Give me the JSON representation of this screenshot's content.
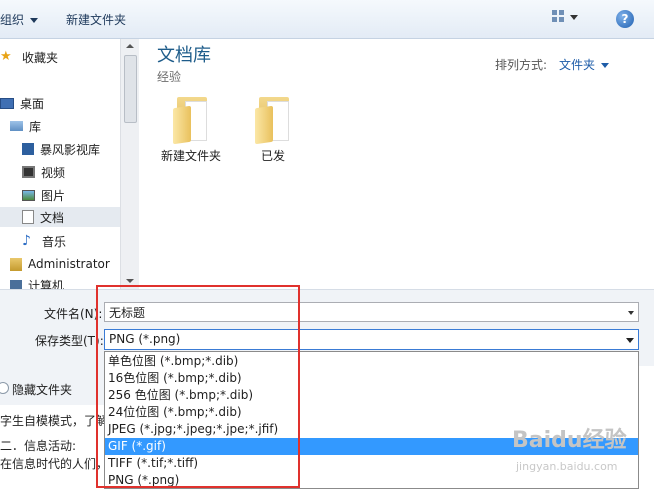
{
  "toolbar": {
    "organize": "组织",
    "new_folder": "新建文件夹",
    "help": "?"
  },
  "sidebar": {
    "items": [
      {
        "label": "收藏夹",
        "icon": "star-icon"
      },
      {
        "label": "桌面",
        "icon": "desktop-icon"
      },
      {
        "label": "库",
        "icon": "library-icon"
      },
      {
        "label": "暴风影视库",
        "icon": "video-library-icon"
      },
      {
        "label": "视频",
        "icon": "video-icon"
      },
      {
        "label": "图片",
        "icon": "picture-icon"
      },
      {
        "label": "文档",
        "icon": "document-icon"
      },
      {
        "label": "音乐",
        "icon": "music-icon"
      },
      {
        "label": "Administrator",
        "icon": "user-icon"
      },
      {
        "label": "计算机",
        "icon": "computer-icon"
      }
    ]
  },
  "main": {
    "title": "文档库",
    "subtitle": "经验",
    "arrange_label": "排列方式:",
    "arrange_value": "文件夹",
    "folders": [
      {
        "name": "新建文件夹"
      },
      {
        "name": "已发"
      }
    ]
  },
  "form": {
    "filename_label": "文件名(N):",
    "filename_value": "无标题",
    "filetype_label": "保存类型(T):",
    "filetype_value": "PNG (*.png)"
  },
  "hide_folders": "隐藏文件夹",
  "background_text": {
    "line1": "字生自模模式，了解",
    "line2": "二．信息活动:",
    "line3": "在信息时代的人们，"
  },
  "dropdown": {
    "options": [
      "单色位图 (*.bmp;*.dib)",
      "16色位图 (*.bmp;*.dib)",
      "256 色位图 (*.bmp;*.dib)",
      "24位位图 (*.bmp;*.dib)",
      "JPEG (*.jpg;*.jpeg;*.jpe;*.jfif)",
      "GIF (*.gif)",
      "TIFF (*.tif;*.tiff)",
      "PNG (*.png)"
    ],
    "highlighted_index": 5
  },
  "watermark": {
    "brand": "Baidu经验",
    "url": "jingyan.baidu.com"
  },
  "colors": {
    "highlight": "#3399ff",
    "annotation_box": "#e0312d",
    "title": "#1e5c8a"
  }
}
